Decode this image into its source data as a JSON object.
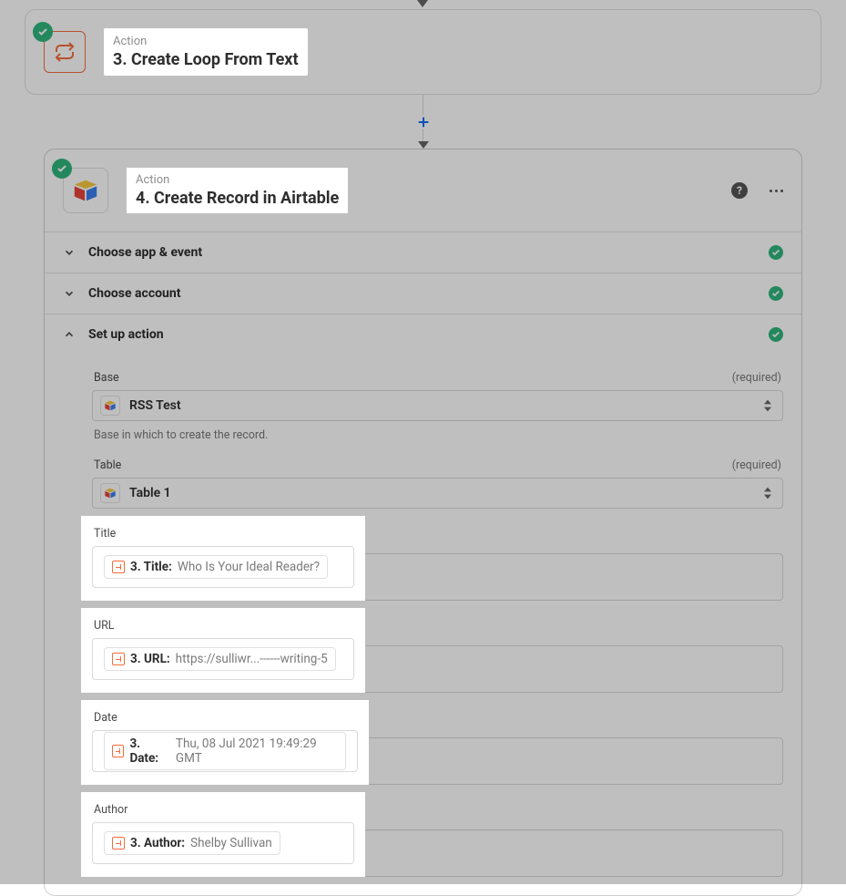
{
  "step3": {
    "eyebrow": "Action",
    "title": "3. Create Loop From Text"
  },
  "step4": {
    "eyebrow": "Action",
    "title": "4. Create Record in Airtable",
    "sections": {
      "app_event": "Choose app & event",
      "account": "Choose account",
      "setup": "Set up action"
    }
  },
  "form": {
    "base": {
      "label": "Base",
      "required_text": "(required)",
      "value": "RSS Test",
      "help": "Base in which to create the record."
    },
    "table": {
      "label": "Table",
      "required_text": "(required)",
      "value": "Table 1"
    },
    "title_field": {
      "label": "Title",
      "pill_key": "3. Title:",
      "pill_value": "Who Is Your Ideal Reader?"
    },
    "url_field": {
      "label": "URL",
      "pill_key": "3. URL:",
      "pill_value": "https://sulliwr...------writing-5"
    },
    "date_field": {
      "label": "Date",
      "pill_key": "3. Date:",
      "pill_value": "Thu, 08 Jul 2021 19:49:29 GMT"
    },
    "author_field": {
      "label": "Author",
      "pill_key": "3. Author:",
      "pill_value": "Shelby Sullivan"
    }
  }
}
